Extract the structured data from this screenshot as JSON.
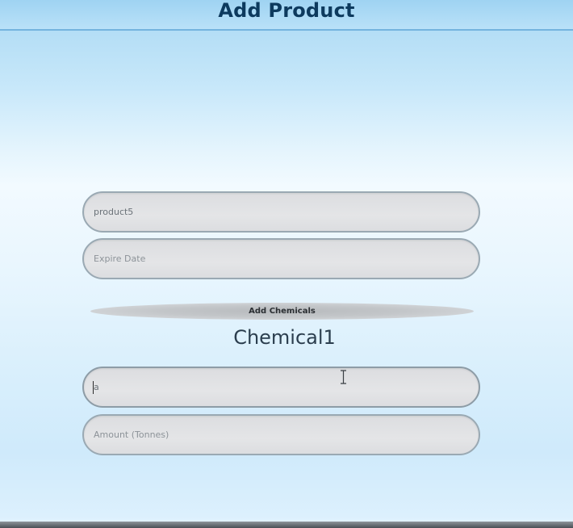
{
  "header": {
    "title": "Add Product"
  },
  "form": {
    "product_name": {
      "value": "product5",
      "placeholder": ""
    },
    "expire_date": {
      "value": "",
      "placeholder": "Expire Date"
    },
    "add_chemicals_label": "Add Chemicals",
    "chemical_section_title": "Chemical1",
    "chemical_name": {
      "value": "a",
      "placeholder": ""
    },
    "chemical_amount": {
      "value": "",
      "placeholder": "Amount (Tonnes)"
    }
  },
  "colors": {
    "header_background": "#a9d8f3",
    "title_text": "#0d3a5e",
    "field_background": "#e0e1e3",
    "field_border": "#9aa9b3"
  },
  "icons": {
    "cursor": "text-cursor-icon"
  }
}
